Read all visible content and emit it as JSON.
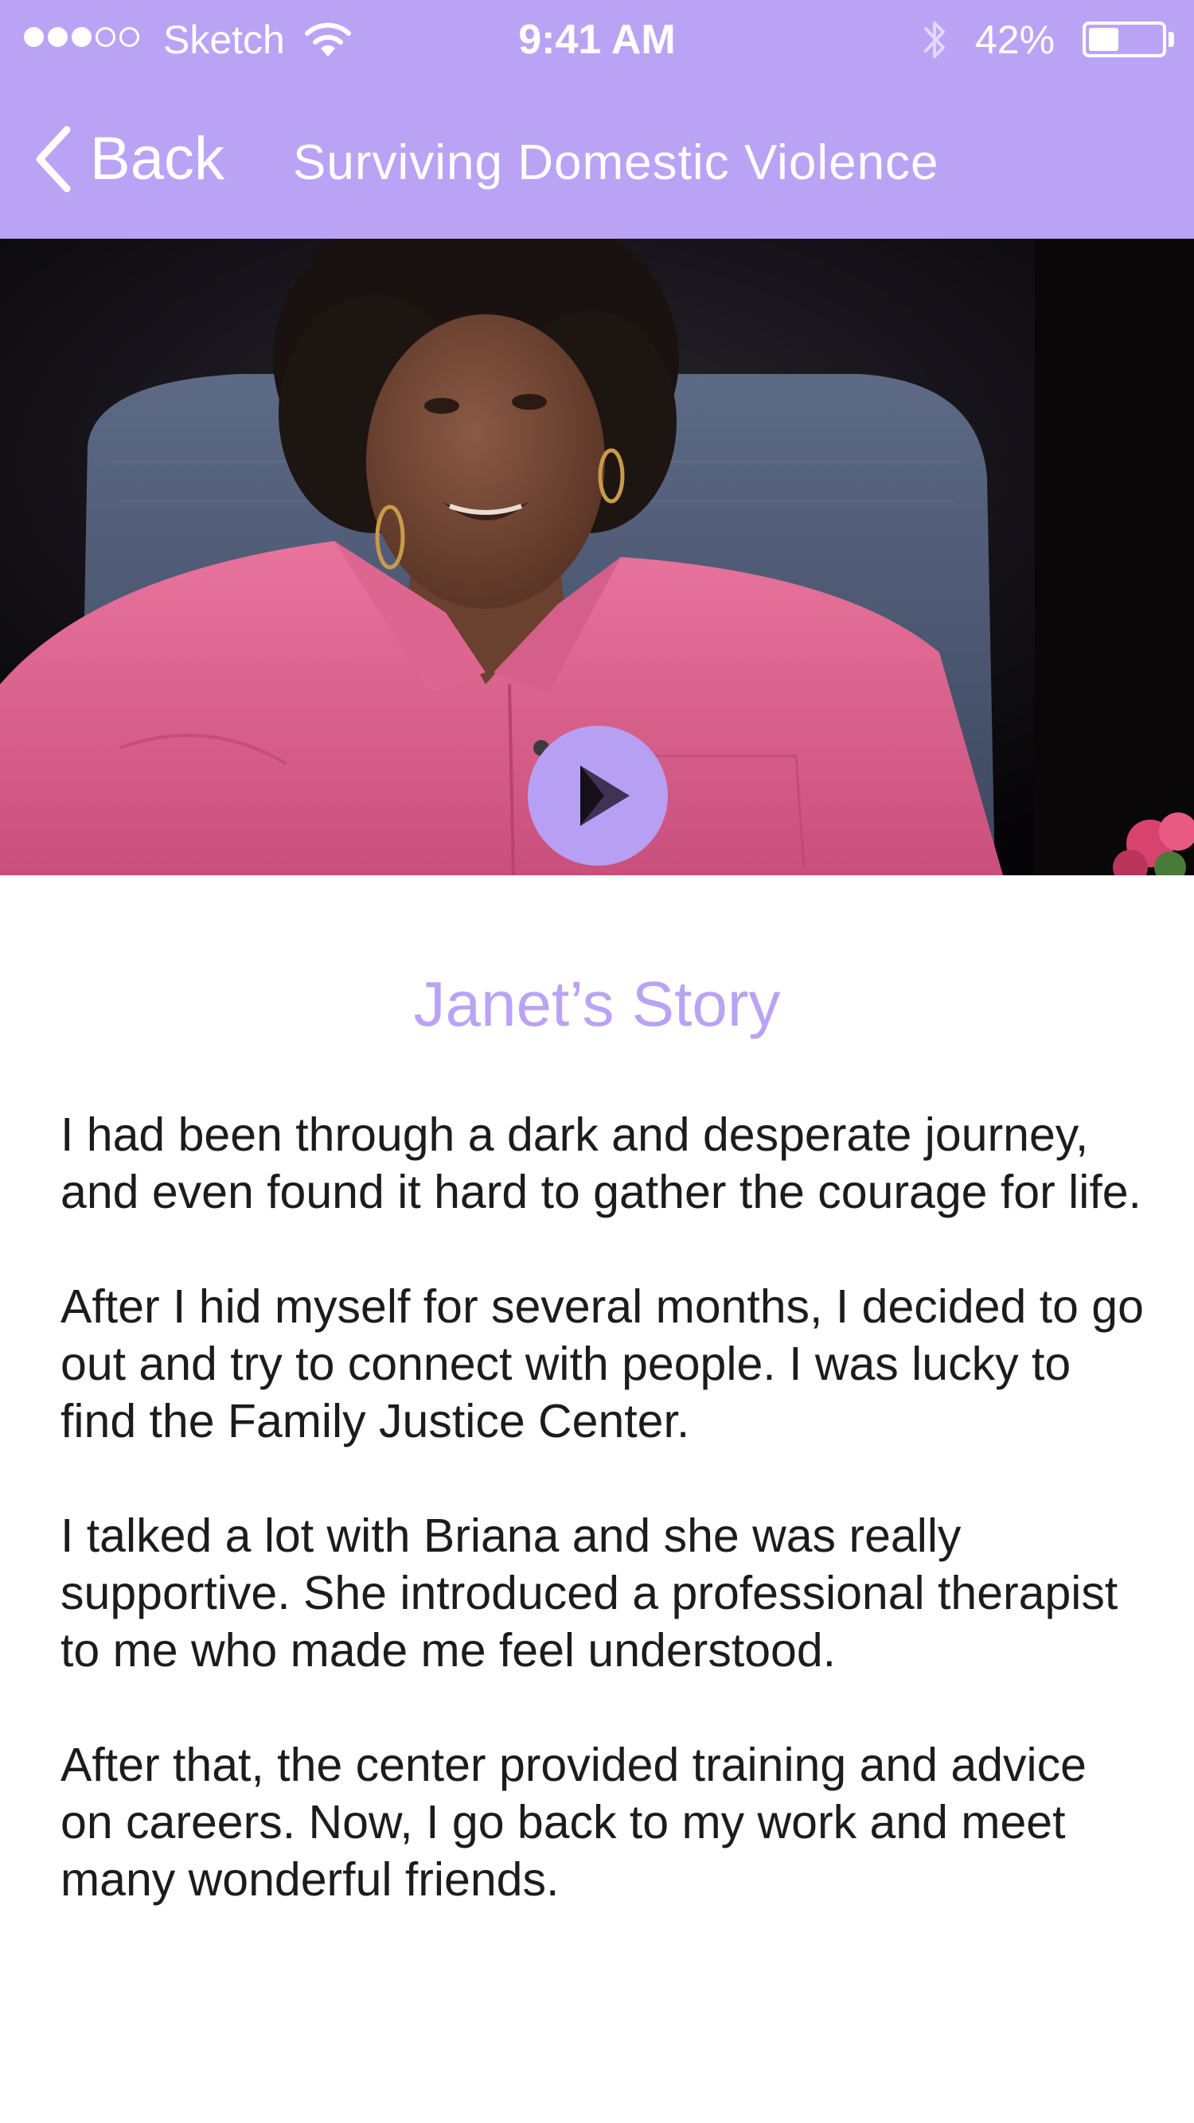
{
  "status_bar": {
    "carrier": "Sketch",
    "time": "9:41 AM",
    "battery_percent": "42%",
    "battery_level": 0.42,
    "signal_bars_filled": 3,
    "signal_bars_total": 5
  },
  "nav": {
    "back_label": "Back",
    "title": "Surviving Domestic Violence"
  },
  "video": {
    "play_icon": "play-icon"
  },
  "story": {
    "title": "Janet’s Story",
    "paragraphs": [
      "I had been through a dark and desperate journey, and even found it hard to gather the courage for life.",
      "After I hid myself for several months, I decided to go out and try to connect with people. I was lucky to find the Family Justice Center.",
      "I talked a lot with Briana and she was really supportive. She introduced a professional therapist to me who made me feel understood.",
      "After that, the center provided training and advice on careers. Now, I go back to my work and meet many wonderful friends."
    ]
  },
  "colors": {
    "accent": "#baa3f5",
    "text": "#1c1c1c",
    "background": "#ffffff"
  }
}
